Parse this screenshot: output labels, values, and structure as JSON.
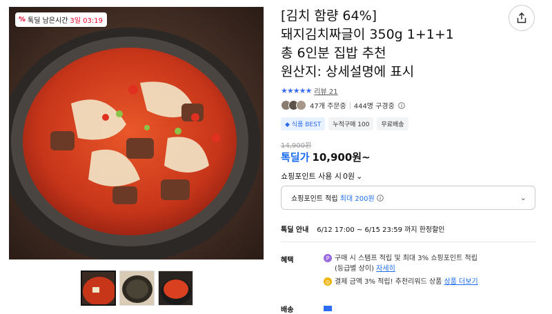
{
  "badge": {
    "icon": "percent-icon",
    "label": "톡딜 남은시간",
    "time": "3일 03:19"
  },
  "title": "[김치 함량 64%]\n돼지김치짜글이 350g 1+1+1\n총 6인분 집밥 추천\n원산지: 상세설명에 표시",
  "rating": {
    "stars": "★★★★★",
    "stars_value": 5,
    "review_label": "리뷰 21"
  },
  "buyers": {
    "ordering": "47개 주문중",
    "subscribers": "444명 구경중"
  },
  "tags": [
    "식품 BEST",
    "누적구매 100",
    "무료배송"
  ],
  "price": {
    "original": "14,900원",
    "deal_label": "톡딜가",
    "deal_price": "10,900원~"
  },
  "point_use": {
    "label": "쇼핑포인트 사용 시",
    "value": "0원"
  },
  "point_accrual": {
    "label": "쇼핑포인트 적립",
    "max_label": "최대 200원"
  },
  "deal_info": {
    "label": "톡딜 안내",
    "period": "6/12 17:00 ~ 6/15 23:59 까지 한정할인"
  },
  "benefits": {
    "label": "혜택",
    "items": [
      {
        "text": "구매 시 스탬프 적립 및 최대 3% 쇼핑포인트 적립",
        "sub": "(등급별 상이)",
        "link": "자세히"
      },
      {
        "text": "결제 금액 3% 적립! 추천리워드 상품",
        "link": "상품 더보기"
      }
    ]
  },
  "shipping": {
    "label": "배송"
  },
  "colors": {
    "accent": "#1a6cf0",
    "deal_red": "#e8002b",
    "star": "#3b6ef5"
  }
}
